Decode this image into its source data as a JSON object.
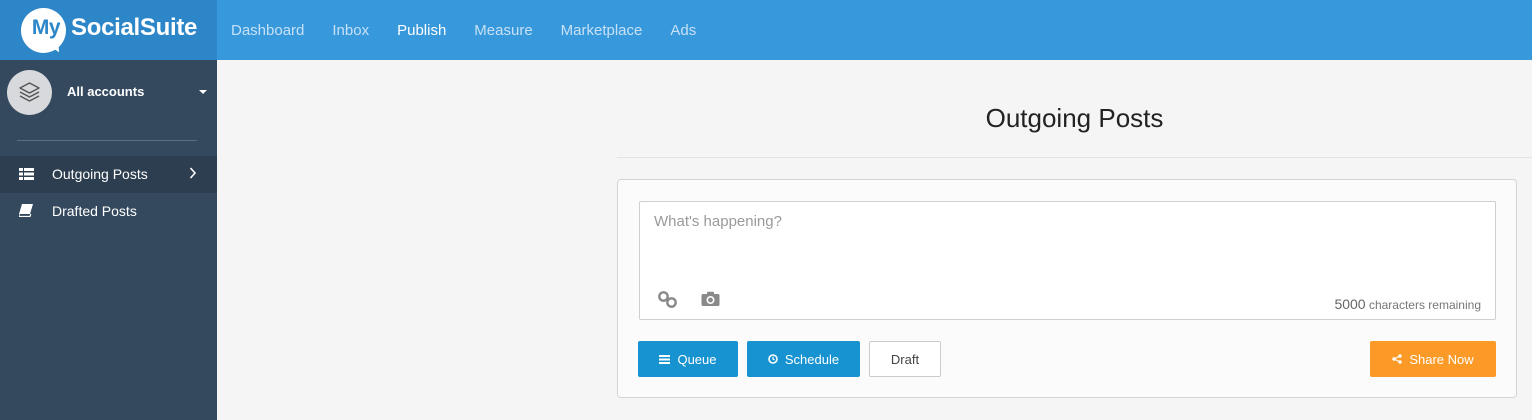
{
  "brand": {
    "logo_my": "My",
    "logo_text": "SocialSuite"
  },
  "nav": [
    {
      "label": "Dashboard",
      "active": false
    },
    {
      "label": "Inbox",
      "active": false
    },
    {
      "label": "Publish",
      "active": true
    },
    {
      "label": "Measure",
      "active": false
    },
    {
      "label": "Marketplace",
      "active": false
    },
    {
      "label": "Ads",
      "active": false
    }
  ],
  "sidebar": {
    "account_label": "All accounts",
    "items": [
      {
        "label": "Outgoing Posts",
        "icon": "list-icon",
        "active": true
      },
      {
        "label": "Drafted Posts",
        "icon": "book-icon",
        "active": false
      }
    ]
  },
  "main": {
    "title": "Outgoing Posts",
    "composer": {
      "placeholder": "What's happening?",
      "char_count": "5000",
      "char_suffix": "characters remaining"
    },
    "buttons": {
      "queue": "Queue",
      "schedule": "Schedule",
      "draft": "Draft",
      "share": "Share Now"
    }
  },
  "colors": {
    "topbar": "#3898dc",
    "sidebar": "#34495e",
    "primary_button": "#1793d1",
    "share_button": "#fb9a26"
  }
}
